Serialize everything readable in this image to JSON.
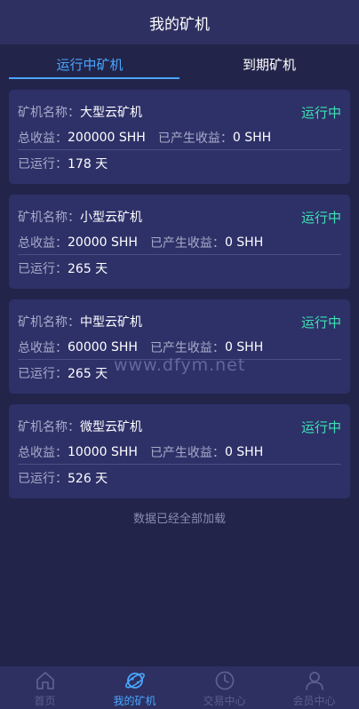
{
  "header": {
    "title": "我的矿机"
  },
  "tabs": [
    {
      "label": "运行中矿机",
      "active": true
    },
    {
      "label": "到期矿机",
      "active": false
    }
  ],
  "labels": {
    "name": "矿机名称：",
    "total": "总收益：",
    "produced": "已产生收益：",
    "running": "已运行："
  },
  "miners": [
    {
      "name": "大型云矿机",
      "status": "运行中",
      "total": "200000 SHH",
      "produced": "0 SHH",
      "days": "178 天"
    },
    {
      "name": "小型云矿机",
      "status": "运行中",
      "total": "20000 SHH",
      "produced": "0 SHH",
      "days": "265 天"
    },
    {
      "name": "中型云矿机",
      "status": "运行中",
      "total": "60000 SHH",
      "produced": "0 SHH",
      "days": "265 天"
    },
    {
      "name": "微型云矿机",
      "status": "运行中",
      "total": "10000 SHH",
      "produced": "0 SHH",
      "days": "526 天"
    }
  ],
  "footer": {
    "loaded_text": "数据已经全部加载"
  },
  "watermark": "www.dfym.net",
  "nav": [
    {
      "label": "首页",
      "icon": "home-icon",
      "active": false
    },
    {
      "label": "我的矿机",
      "icon": "planet-icon",
      "active": true
    },
    {
      "label": "交易中心",
      "icon": "clock-icon",
      "active": false
    },
    {
      "label": "会员中心",
      "icon": "user-icon",
      "active": false
    }
  ],
  "colors": {
    "accent": "#4aa6ff",
    "status": "#3ee0b4",
    "background": "#22244a",
    "card": "#2e3168"
  }
}
